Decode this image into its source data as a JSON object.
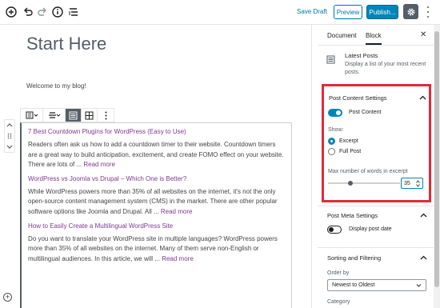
{
  "toolbar": {
    "save_draft": "Save Draft",
    "preview": "Preview",
    "publish": "Publish..."
  },
  "editor": {
    "title": "Start Here",
    "welcome": "Welcome to my blog!",
    "posts": [
      {
        "title": "7 Best Countdown Plugins for WordPress (Easy to Use)",
        "excerpt": "Readers often ask us how to add a countdown timer to their website. Countdown timers are a great way to build anticipation, excitement, and create FOMO effect on your website. There are lots of ...",
        "more": "Read more"
      },
      {
        "title": "WordPress vs Joomla vs Drupal – Which One is Better?",
        "excerpt": "While WordPress powers more than 35% of all websites on the internet, it's not the only open-source content management system (CMS) in the market. There are other popular software options like Joomla and Drupal. All ...",
        "more": "Read more"
      },
      {
        "title": "How to Easily Create a Multilingual WordPress Site",
        "excerpt": "Do you want to translate your WordPress site in multiple languages? WordPress powers more than 35% of all websites on the internet. Many of them serve non-English or multilingual audiences. In this article, we will ...",
        "more": "Read more"
      }
    ]
  },
  "sidebar": {
    "tabs": [
      "Document",
      "Block"
    ],
    "active_tab": "Block",
    "block_name": "Latest Posts",
    "block_desc": "Display a list of your most recent posts.",
    "post_content": {
      "title": "Post Content Settings",
      "toggle_label": "Post Content",
      "toggle_on": true,
      "show_label": "Show:",
      "options": [
        "Excerpt",
        "Full Post"
      ],
      "selected_option": "Excerpt",
      "words_label": "Max number of words in excerpt",
      "words_value": "35",
      "words_fraction": 0.35
    },
    "post_meta": {
      "title": "Post Meta Settings",
      "toggle_label": "Display post date",
      "toggle_on": false
    },
    "sorting": {
      "title": "Sorting and Filtering",
      "order_label": "Order by",
      "order_value": "Newest to Oldest",
      "category_label": "Category"
    }
  },
  "colors": {
    "accent": "#0085ba",
    "highlight_border": "#e02a39",
    "link": "#7b3a8c"
  }
}
